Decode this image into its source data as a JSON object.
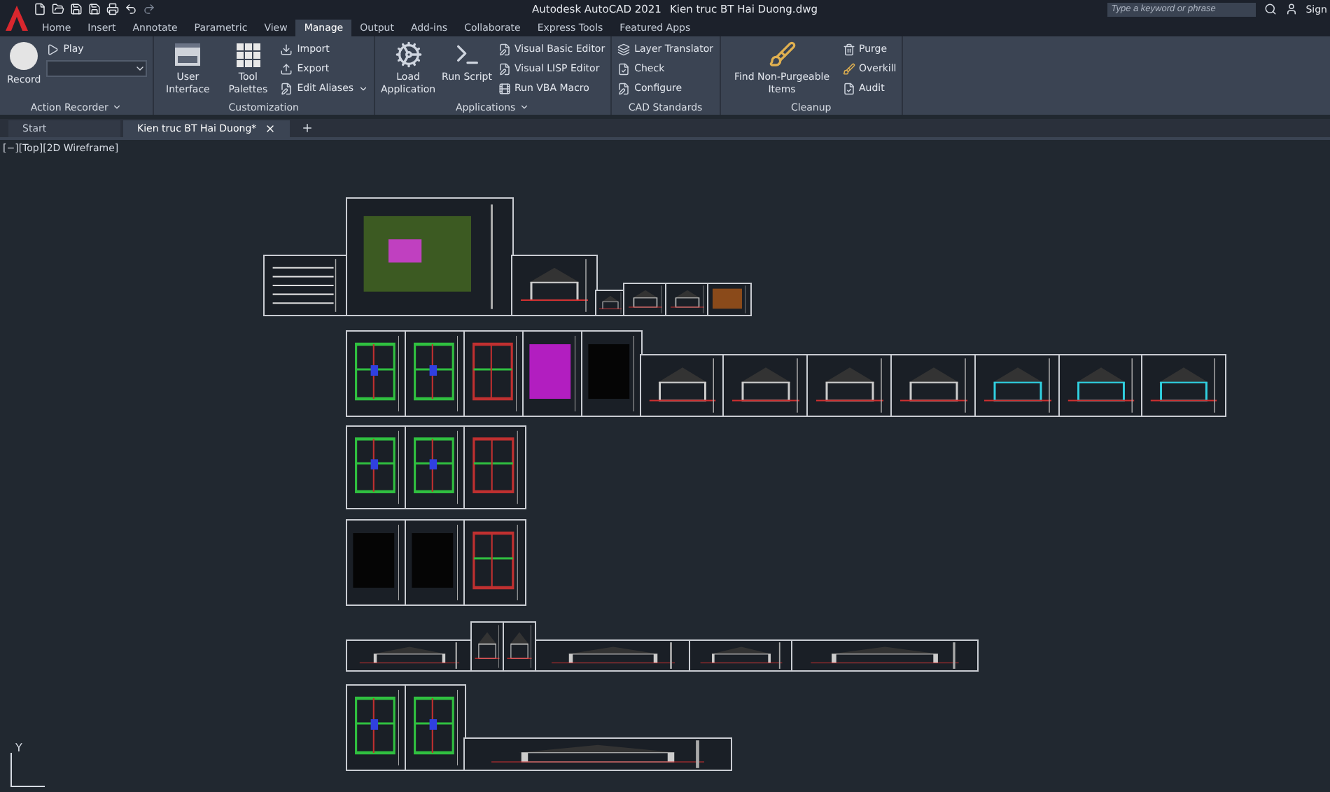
{
  "title_bar": {
    "app_title": "Autodesk AutoCAD 2021",
    "document_title": "Kien truc BT Hai Duong.dwg",
    "search": {
      "placeholder": "Type a keyword or phrase"
    },
    "user_label": "Sign"
  },
  "ribbon_tabs": [
    {
      "label": "Home",
      "selected": false
    },
    {
      "label": "Insert",
      "selected": false
    },
    {
      "label": "Annotate",
      "selected": false
    },
    {
      "label": "Parametric",
      "selected": false
    },
    {
      "label": "View",
      "selected": false
    },
    {
      "label": "Manage",
      "selected": true
    },
    {
      "label": "Output",
      "selected": false
    },
    {
      "label": "Add-ins",
      "selected": false
    },
    {
      "label": "Collaborate",
      "selected": false
    },
    {
      "label": "Express Tools",
      "selected": false
    },
    {
      "label": "Featured Apps",
      "selected": false
    }
  ],
  "panels": [
    {
      "title": "Action Recorder",
      "dropdown": true,
      "tools": [
        {
          "kind": "large",
          "label": "Record",
          "dropdown": false
        },
        {
          "kind": "small",
          "label": "Play",
          "dropdown": false
        },
        {
          "kind": "combo",
          "dropdown": true
        }
      ]
    },
    {
      "title": "Customization",
      "dropdown": false,
      "tools": [
        {
          "kind": "large",
          "label": "User Interface",
          "dropdown": false
        },
        {
          "kind": "large",
          "label": "Tool Palettes",
          "dropdown": false
        },
        {
          "kind": "small",
          "label": "Import",
          "dropdown": false
        },
        {
          "kind": "small",
          "label": "Export",
          "dropdown": false
        },
        {
          "kind": "small",
          "label": "Edit Aliases",
          "dropdown": true
        }
      ]
    },
    {
      "title": "Applications",
      "dropdown": true,
      "tools": [
        {
          "kind": "large",
          "label": "Load Application",
          "dropdown": false
        },
        {
          "kind": "large",
          "label": "Run Script",
          "dropdown": false
        },
        {
          "kind": "small",
          "label": "Visual Basic Editor",
          "dropdown": false
        },
        {
          "kind": "small",
          "label": "Visual LISP Editor",
          "dropdown": false
        },
        {
          "kind": "small",
          "label": "Run VBA Macro",
          "dropdown": false
        }
      ]
    },
    {
      "title": "CAD Standards",
      "dropdown": false,
      "tools": [
        {
          "kind": "small",
          "label": "Layer Translator",
          "dropdown": false
        },
        {
          "kind": "small",
          "label": "Check",
          "dropdown": false
        },
        {
          "kind": "small",
          "label": "Configure",
          "dropdown": false
        }
      ]
    },
    {
      "title": "Cleanup",
      "dropdown": false,
      "tools": [
        {
          "kind": "large",
          "label": "Find Non-Purgeable Items",
          "dropdown": false
        },
        {
          "kind": "small",
          "label": "Purge",
          "dropdown": false
        },
        {
          "kind": "small",
          "label": "Overkill",
          "dropdown": false
        },
        {
          "kind": "small",
          "label": "Audit",
          "dropdown": false
        }
      ]
    }
  ],
  "file_tabs": [
    {
      "label": "Start",
      "selected": false,
      "closable": false
    },
    {
      "label": "Kien truc BT Hai Duong*",
      "selected": true,
      "closable": true
    }
  ],
  "viewport": {
    "label": "[−][Top][2D Wireframe]",
    "ucs_axis": "Y"
  }
}
